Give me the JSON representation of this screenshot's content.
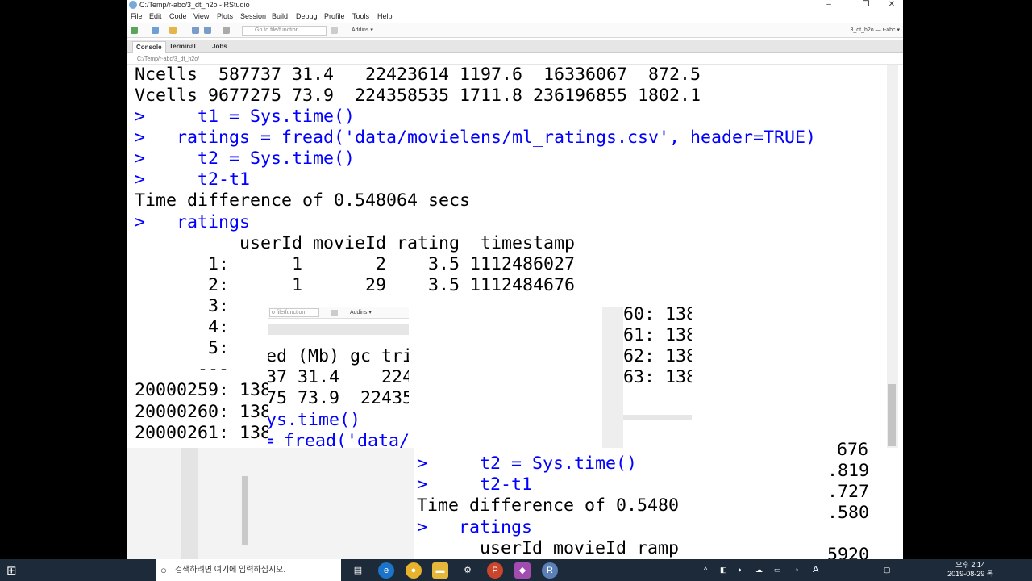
{
  "window": {
    "title": "C:/Temp/r-abc/3_dt_h2o - RStudio",
    "controls": {
      "minimize": "–",
      "maximize": "❐",
      "close": "✕"
    }
  },
  "menu": [
    "File",
    "Edit",
    "Code",
    "View",
    "Plots",
    "Session",
    "Build",
    "Debug",
    "Profile",
    "Tools",
    "Help"
  ],
  "toolbar": {
    "goto_placeholder": "Go to file/function",
    "addins": "Addins ▾",
    "project": "3_dt_h2o — r-abc ▾"
  },
  "tabs": [
    "Console",
    "Terminal",
    "Jobs"
  ],
  "console_path": "C:/Temp/r-abc/3_dt_h2o/",
  "console": {
    "lines": [
      "Ncells  587737 31.4   22423614 1197.6  16336067  872.5",
      "Vcells 9677275 73.9  224358535 1711.8 236196855 1802.1",
      ">     t1 = Sys.time()",
      ">   ratings = fread('data/movielens/ml_ratings.csv', header=TRUE)",
      ">     t2 = Sys.time()",
      ">     t2-t1",
      "Time difference of 0.548064 secs",
      ">   ratings",
      "          userId movieId rating  timestamp",
      "       1:      1       2    3.5 1112486027",
      "       2:      1      29    3.5 1112484676",
      "       3:",
      "       4:",
      "       5:",
      "      ---",
      "20000259: 138",
      "20000260: 138",
      "20000261: 138"
    ]
  },
  "overlay": {
    "goto_placeholder": "o file/function",
    "addins": "Addins ▾",
    "mid_lines": [
      "ed (Mb) gc tri",
      "37 31.4    2242",
      "75 73.9  22435",
      "ys.time()",
      "= fread('data/"
    ],
    "right_lines": [
      "60: 138",
      "61: 138",
      "62: 138",
      "63: 138"
    ],
    "lower_lines": [
      ">     t2 = Sys.time()",
      ">     t2-t1",
      "Time difference of 0.5480",
      ">   ratings",
      "      userId movieId ramp"
    ],
    "far_right_lines": [
      "676",
      ".819",
      ".727",
      ".580",
      "5920"
    ]
  },
  "taskbar": {
    "search_placeholder": "검색하려면 여기에 입력하십시오.",
    "tray_lang": "A",
    "time": "오후 2:14",
    "date": "2019-08-29 목"
  },
  "colors": {
    "prompt_blue": "#0000ff",
    "taskbar": "#1c2a3a"
  }
}
